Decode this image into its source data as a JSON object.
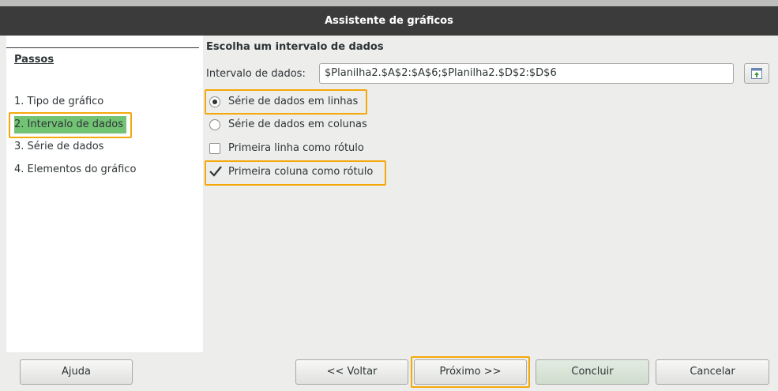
{
  "window": {
    "title": "Assistente de gráficos"
  },
  "steps": {
    "title": "Passos",
    "items": [
      {
        "label": "1. Tipo de gráfico"
      },
      {
        "label": "2. Intervalo de dados"
      },
      {
        "label": "3. Série de dados"
      },
      {
        "label": "4. Elementos do gráfico"
      }
    ],
    "active_index": 1
  },
  "main": {
    "heading": "Escolha um intervalo de dados",
    "range_label": "Intervalo de dados:",
    "range_value": "$Planilha2.$A$2:$A$6;$Planilha2.$D$2:$D$6",
    "options": {
      "rows": {
        "label": "Série de dados em linhas",
        "selected": true
      },
      "columns": {
        "label": "Série de dados em colunas",
        "selected": false
      },
      "first_row_label": {
        "label": "Primeira linha como rótulo",
        "checked": false
      },
      "first_col_label": {
        "label": "Primeira coluna como rótulo",
        "checked": true
      }
    }
  },
  "buttons": {
    "help": "Ajuda",
    "back": "<< Voltar",
    "next": "Próximo >>",
    "finish": "Concluir",
    "cancel": "Cancelar"
  },
  "colors": {
    "active_step": "#73c375",
    "highlight": "#f5a80a",
    "titlebar": "#3b3b3b"
  }
}
